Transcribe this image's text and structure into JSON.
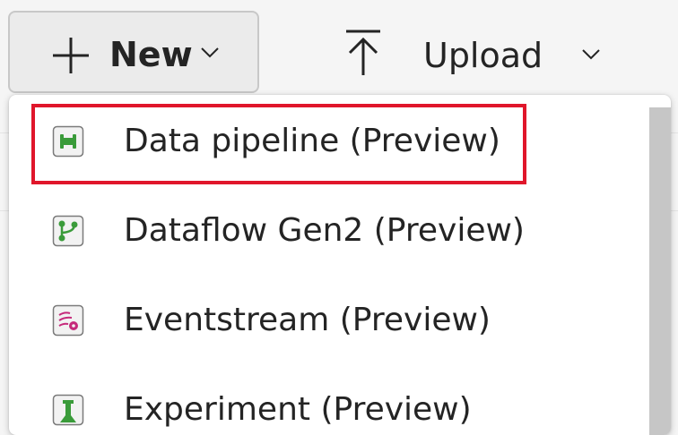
{
  "toolbar": {
    "new_label": "New",
    "upload_label": "Upload"
  },
  "menu": {
    "items": [
      {
        "label": "Data pipeline (Preview)",
        "icon": "data-pipeline-icon",
        "color": "#3a9b3a",
        "highlighted": true
      },
      {
        "label": "Dataflow Gen2 (Preview)",
        "icon": "dataflow-icon",
        "color": "#3a9b3a"
      },
      {
        "label": "Eventstream (Preview)",
        "icon": "eventstream-icon",
        "color": "#c5297a"
      },
      {
        "label": "Experiment (Preview)",
        "icon": "experiment-icon",
        "color": "#3a9b3a"
      }
    ]
  },
  "colors": {
    "highlight_border": "#e0162b",
    "button_bg": "#ebebeb",
    "text": "#242424"
  }
}
